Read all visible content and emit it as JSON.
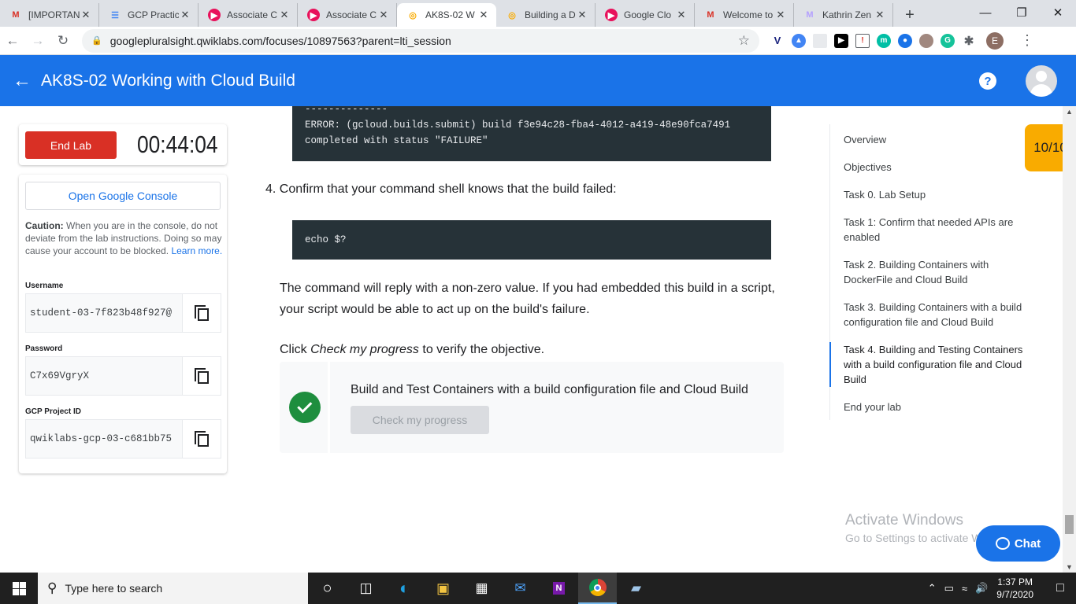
{
  "browser": {
    "tabs": [
      {
        "title": "[IMPORTAN",
        "icon": "gmail-icon",
        "glyph": "M",
        "color": "#d93025",
        "bg": "transparent",
        "active": false
      },
      {
        "title": "GCP Practic",
        "icon": "forms-icon",
        "glyph": "☰",
        "color": "#4285f4",
        "bg": "transparent",
        "active": false
      },
      {
        "title": "Associate C",
        "icon": "pluralsight-icon",
        "glyph": "▶",
        "color": "#fff",
        "bg": "#e8115b",
        "active": false
      },
      {
        "title": "Associate C",
        "icon": "pluralsight-icon",
        "glyph": "▶",
        "color": "#fff",
        "bg": "#e8115b",
        "active": false
      },
      {
        "title": "AK8S-02 W",
        "icon": "qwiklabs-icon",
        "glyph": "◎",
        "color": "#f9ab00",
        "bg": "transparent",
        "active": true
      },
      {
        "title": "Building a D",
        "icon": "qwiklabs-icon",
        "glyph": "◎",
        "color": "#f9ab00",
        "bg": "transparent",
        "active": false
      },
      {
        "title": "Google Clo",
        "icon": "pluralsight-icon",
        "glyph": "▶",
        "color": "#fff",
        "bg": "#e8115b",
        "active": false
      },
      {
        "title": "Welcome to",
        "icon": "gmail-icon",
        "glyph": "M",
        "color": "#d93025",
        "bg": "transparent",
        "active": false
      },
      {
        "title": "Kathrin Zen",
        "icon": "ms-icon",
        "glyph": "M",
        "color": "#b4a0ff",
        "bg": "transparent",
        "active": false
      }
    ],
    "new_tab": "+",
    "url": "googlepluralsight.qwiklabs.com/focuses/10897563?parent=lti_session",
    "profile_initial": "E"
  },
  "header": {
    "back": "←",
    "title": "AK8S-02 Working with Cloud Build",
    "help": "?"
  },
  "sidebar": {
    "end_lab": "End Lab",
    "timer": "00:44:04",
    "open_console": "Open Google Console",
    "caution_bold": "Caution:",
    "caution_text": " When you are in the console, do not deviate from the lab instructions. Doing so may cause your account to be blocked. ",
    "learn_more": "Learn more.",
    "username_label": "Username",
    "username": "student-03-7f823b48f927@",
    "password_label": "Password",
    "password": "C7x69VgryX",
    "project_label": "GCP Project ID",
    "project_id": "qwiklabs-gcp-03-c681bb75"
  },
  "content": {
    "code1_dashes": "--------------",
    "code1_line1": "ERROR: (gcloud.builds.submit) build f3e94c28-fba4-4012-a419-48e90fca7491",
    "code1_line2": "completed with status \"FAILURE\"",
    "step4": "4. Confirm that your command shell knows that the build failed:",
    "code2": "echo $?",
    "para1": "The command will reply with a non-zero value. If you had embedded this build in a script, your script would be able to act up on the build's failure.",
    "click_prefix": "Click ",
    "click_em": "Check my progress",
    "click_suffix": " to verify the objective.",
    "objective": "Build and Test Containers with a build configuration file and Cloud Build",
    "check_progress": "Check my progress"
  },
  "toc": {
    "items": [
      "Overview",
      "Objectives",
      "Task 0. Lab Setup",
      "Task 1: Confirm that needed APIs are enabled",
      "Task 2. Building Containers with DockerFile and Cloud Build",
      "Task 3. Building Containers with a build configuration file and Cloud Build",
      "Task 4. Building and Testing Containers with a build configuration file and Cloud Build",
      "End your lab"
    ],
    "active_index": 6
  },
  "score": "10/10",
  "watermark": {
    "line1": "Activate Windows",
    "line2": "Go to Settings to activate Windows."
  },
  "chat": "Chat",
  "taskbar": {
    "search_placeholder": "Type here to search",
    "time": "1:37 PM",
    "date": "9/7/2020"
  }
}
